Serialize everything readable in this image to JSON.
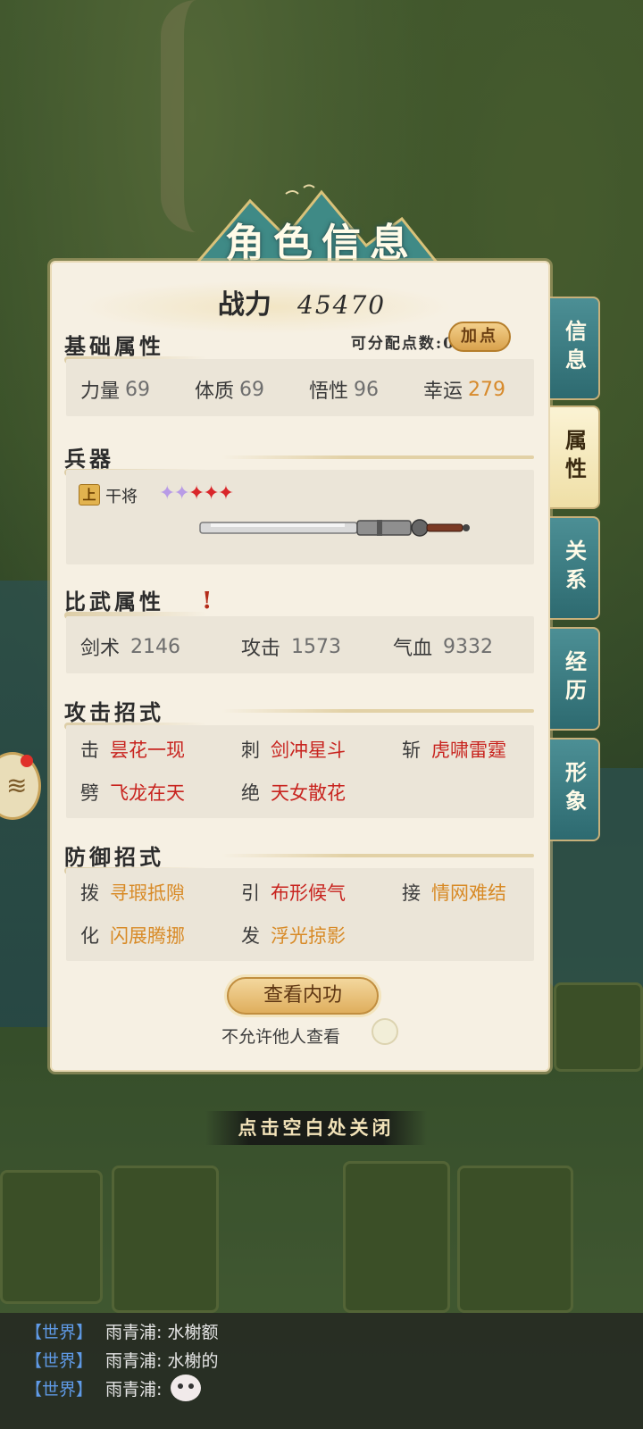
{
  "panel": {
    "title": "角色信息",
    "power_label": "战力",
    "power_value": "45470"
  },
  "basic": {
    "title": "基础属性",
    "points_label": "可分配点数:0",
    "add_button": "加点",
    "stats": [
      {
        "label": "力量",
        "value": "69"
      },
      {
        "label": "体质",
        "value": "69"
      },
      {
        "label": "悟性",
        "value": "96"
      },
      {
        "label": "幸运",
        "value": "279"
      }
    ]
  },
  "weapon": {
    "title": "兵器",
    "grade": "上",
    "name": "干将",
    "stars": [
      "purple",
      "purple",
      "red",
      "red",
      "red"
    ]
  },
  "duel": {
    "title": "比武属性",
    "stats": [
      {
        "label": "剑术",
        "value": "2146"
      },
      {
        "label": "攻击",
        "value": "1573"
      },
      {
        "label": "气血",
        "value": "9332"
      }
    ]
  },
  "attack": {
    "title": "攻击招式",
    "moves": [
      {
        "key": "击",
        "name": "昙花一现",
        "color": "red"
      },
      {
        "key": "刺",
        "name": "剑冲星斗",
        "color": "red"
      },
      {
        "key": "斩",
        "name": "虎啸雷霆",
        "color": "red"
      },
      {
        "key": "劈",
        "name": "飞龙在天",
        "color": "red"
      },
      {
        "key": "绝",
        "name": "天女散花",
        "color": "red"
      }
    ]
  },
  "defense": {
    "title": "防御招式",
    "moves": [
      {
        "key": "拨",
        "name": "寻瑕抵隙",
        "color": "orange"
      },
      {
        "key": "引",
        "name": "布形候气",
        "color": "red"
      },
      {
        "key": "接",
        "name": "情网难结",
        "color": "orange"
      },
      {
        "key": "化",
        "name": "闪展腾挪",
        "color": "orange"
      },
      {
        "key": "发",
        "name": "浮光掠影",
        "color": "orange"
      }
    ]
  },
  "actions": {
    "view_inner": "查看内功",
    "privacy_label": "不允许他人查看"
  },
  "tabs": [
    "信息",
    "属性",
    "关系",
    "经历",
    "形象"
  ],
  "active_tab": "属性",
  "close_hint": "点击空白处关闭",
  "chat": [
    {
      "channel": "【世界】",
      "text": "雨青浦: 水榭额"
    },
    {
      "channel": "【世界】",
      "text": "雨青浦: 水榭的"
    },
    {
      "channel": "【世界】",
      "text": "雨青浦:"
    }
  ],
  "colors": {
    "red": "#c8241f",
    "orange": "#d88a26",
    "tab_teal": "#2d6a70",
    "panel_bg": "#f6f0e3"
  }
}
